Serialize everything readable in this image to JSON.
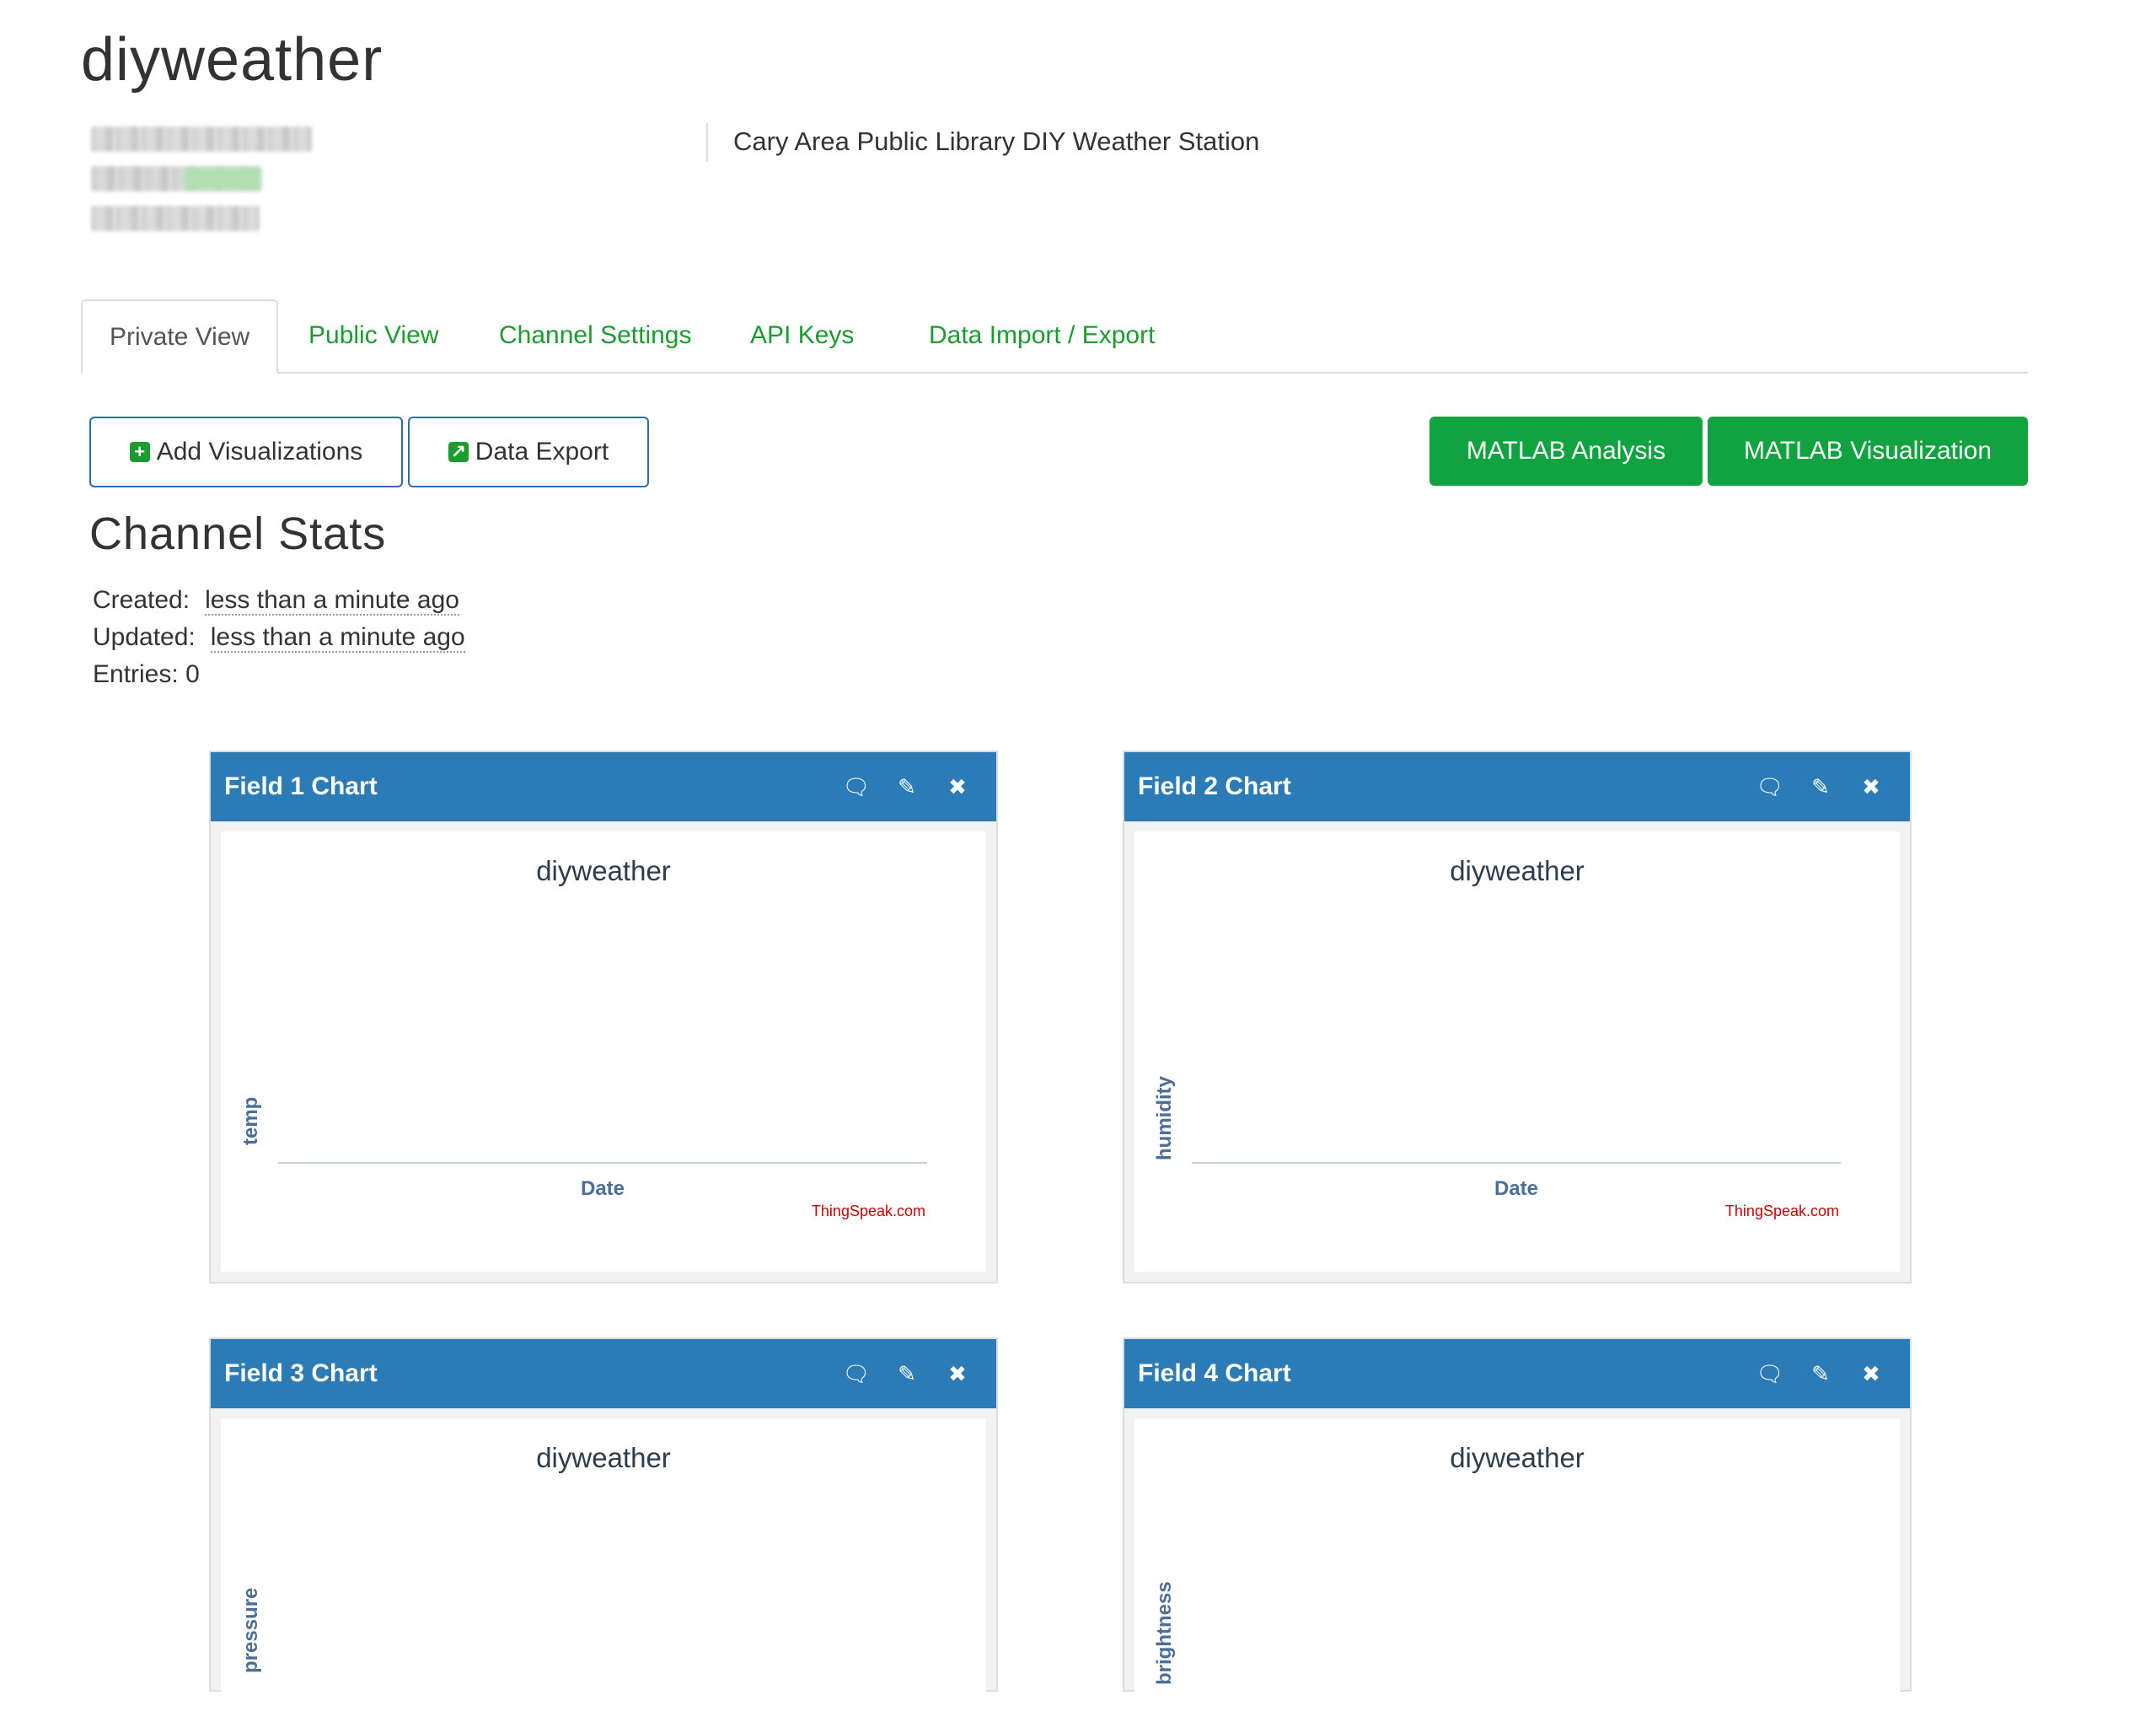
{
  "channel": {
    "name": "diyweather",
    "description": "Cary Area Public Library DIY Weather Station"
  },
  "tabs": [
    {
      "label": "Private View",
      "active": true
    },
    {
      "label": "Public View",
      "active": false
    },
    {
      "label": "Channel Settings",
      "active": false
    },
    {
      "label": "API Keys",
      "active": false
    },
    {
      "label": "Data Import / Export",
      "active": false
    }
  ],
  "toolbar": {
    "add_visualizations": "Add Visualizations",
    "data_export": "Data Export",
    "matlab_analysis": "MATLAB Analysis",
    "matlab_visualization": "MATLAB Visualization"
  },
  "stats": {
    "title": "Channel Stats",
    "created_label": "Created:",
    "created_value": "less than a minute ago",
    "updated_label": "Updated:",
    "updated_value": "less than a minute ago",
    "entries_label": "Entries:",
    "entries_value": "0"
  },
  "charts": [
    {
      "header": "Field 1 Chart",
      "title": "diyweather",
      "ylabel": "temp",
      "xlabel": "Date",
      "credit": "ThingSpeak.com"
    },
    {
      "header": "Field 2 Chart",
      "title": "diyweather",
      "ylabel": "humidity",
      "xlabel": "Date",
      "credit": "ThingSpeak.com"
    },
    {
      "header": "Field 3 Chart",
      "title": "diyweather",
      "ylabel": "pressure"
    },
    {
      "header": "Field 4 Chart",
      "title": "diyweather",
      "ylabel": "brightness"
    }
  ],
  "icons": {
    "comment": "comment-icon",
    "edit": "pencil-icon",
    "close": "close-icon",
    "add": "plus-square-icon",
    "export": "external-link-icon"
  },
  "colors": {
    "link_green": "#1a9c2e",
    "button_green": "#10a33f",
    "panel_blue": "#2b7bb6",
    "button_border_blue": "#2a6cae",
    "credit_red": "#cc0000"
  }
}
